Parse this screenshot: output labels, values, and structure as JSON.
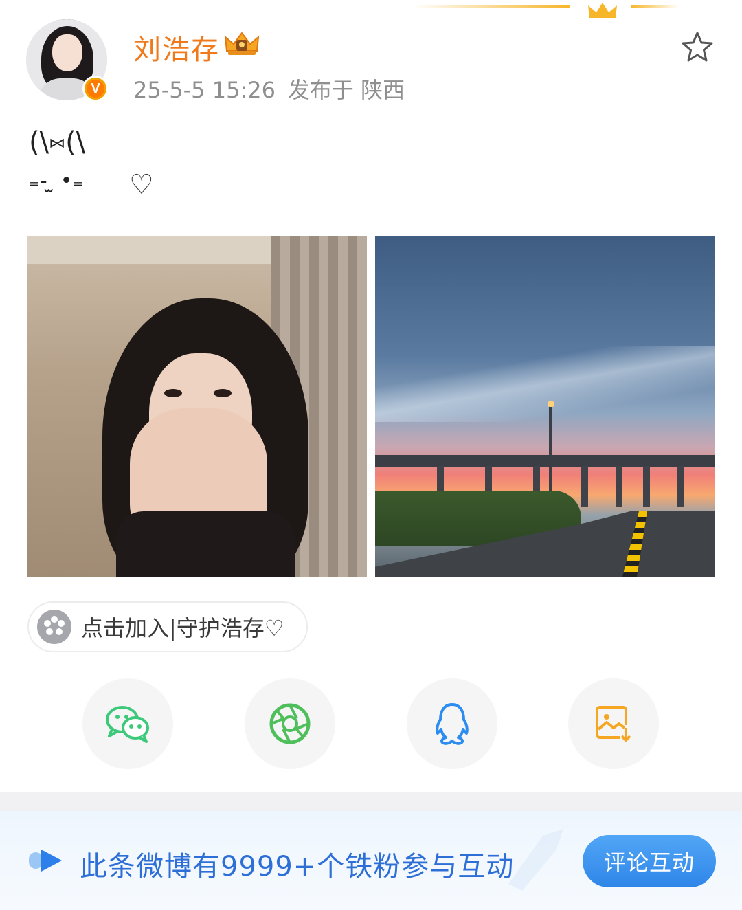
{
  "post": {
    "author": {
      "name": "刘浩存",
      "verified_badge": "V",
      "avatar_icon": "avatar-photo",
      "vip_icon": "crown-vip-icon"
    },
    "timestamp": "25-5-5 15:26",
    "location": "发布于 陕西",
    "text_line1": "(\\⑅(\\",
    "text_line2": "₌- ̫ •₌",
    "text_heart": "♡",
    "images": [
      {
        "name": "selfie-photo"
      },
      {
        "name": "sunset-overpass-photo"
      }
    ]
  },
  "super_topic": {
    "label": "点击加入|守护浩存♡"
  },
  "share": {
    "items": [
      {
        "name": "wechat",
        "icon": "wechat-icon",
        "color": "#3cc97a"
      },
      {
        "name": "moments",
        "icon": "moments-icon",
        "color": "#4fbf5b"
      },
      {
        "name": "qq",
        "icon": "qq-icon",
        "color": "#2d8cf0"
      },
      {
        "name": "save-image",
        "icon": "save-image-icon",
        "color": "#f5a623"
      }
    ]
  },
  "banner": {
    "text": "此条微博有9999+个铁粉参与互动",
    "button_label": "评论互动"
  },
  "colors": {
    "username": "#f07a1b",
    "meta": "#8f8f8f",
    "banner_text": "#2d6fd6",
    "button": "#2f86e8"
  }
}
